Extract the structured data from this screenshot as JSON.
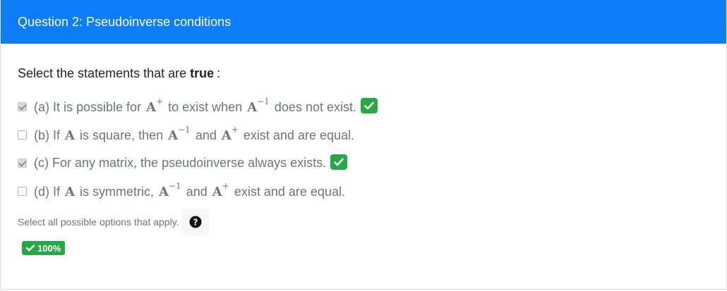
{
  "header": {
    "title": "Question 2: Pseudoinverse conditions"
  },
  "prompt": {
    "prefix": "Select the statements that are",
    "emphasis": "true",
    "suffix": ":"
  },
  "options": [
    {
      "label": "(a)",
      "checked": true,
      "correct_shown": true,
      "parts": [
        "It is possible for",
        "A",
        "+",
        "to exist when",
        "A",
        "−1",
        "does not exist."
      ]
    },
    {
      "label": "(b)",
      "checked": false,
      "correct_shown": false,
      "parts": [
        "If",
        "A",
        "is square, then",
        "A",
        "−1",
        "and",
        "A",
        "+",
        "exist and are equal."
      ]
    },
    {
      "label": "(c)",
      "checked": true,
      "correct_shown": true,
      "parts": [
        "For any matrix, the pseudoinverse always exists."
      ]
    },
    {
      "label": "(d)",
      "checked": false,
      "correct_shown": false,
      "parts": [
        "If",
        "A",
        "is symmetric,",
        "A",
        "−1",
        "and",
        "A",
        "+",
        "exist and are equal."
      ]
    }
  ],
  "help": {
    "text": "Select all possible options that apply.",
    "icon": "question-circle-icon"
  },
  "score": {
    "value": "100%",
    "icon": "check-icon"
  },
  "colors": {
    "header_bg": "#0d7ef7",
    "success": "#28a745",
    "muted_text": "#6c757d"
  }
}
